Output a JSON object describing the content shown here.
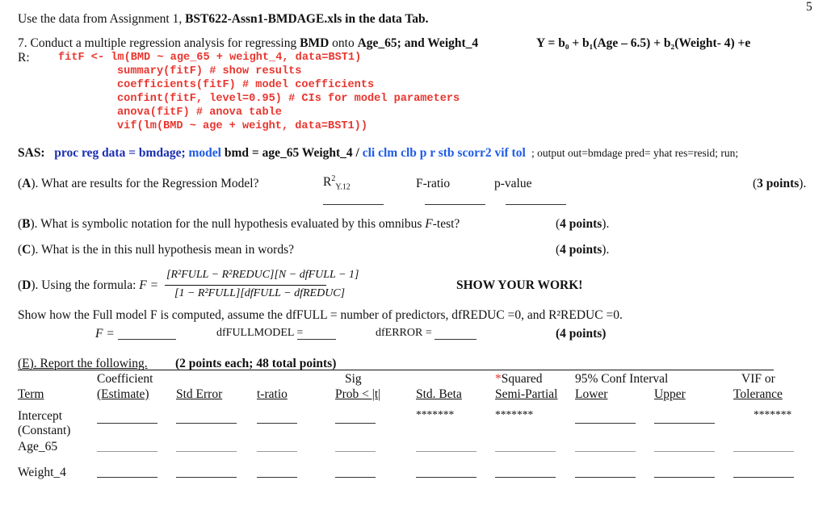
{
  "page_number": "5",
  "intro": {
    "prefix": "Use the data from Assignment 1, ",
    "file": "BST622-Assn1-BMDAGE.xls in the data Tab."
  },
  "q7": {
    "prefix": "7. Conduct a multiple regression analysis for regressing ",
    "bmd": "BMD",
    "onto": " onto ",
    "vars": "Age_65; and Weight_4",
    "model_eq": "Y = b₀ + b₁(Age – 6.5) + b₂(Weight- 4) +e"
  },
  "r_label": "R:",
  "r_code": [
    "fitF <- lm(BMD ~ age_65 + weight_4, data=BST1)",
    "summary(fitF) # show results",
    "coefficients(fitF) # model coefficients",
    "confint(fitF, level=0.95) # CIs for model parameters",
    "anova(fitF) # anova table",
    "vif(lm(BMD ~ age + weight, data=BST1))"
  ],
  "sas": {
    "label": "SAS:",
    "proc": "proc reg data = bmdage;",
    "model_kw": "model",
    "model_rest": " bmd = age_65 Weight_4 / ",
    "options": "cli clm clb p r stb scorr2 vif tol",
    "tail": " ; output out=bmdage  pred= yhat  res=resid;  run;"
  },
  "A": {
    "label": "A",
    "text": "). What are results for the Regression Model?",
    "r2": "R",
    "r2_sup": "2",
    "r2_sub": "Y.12",
    "fratio": "F-ratio",
    "pvalue": "p-value",
    "points": "3 points"
  },
  "B": {
    "label": "B",
    "text": ").  What is symbolic notation for the null hypothesis evaluated by this omnibus ",
    "f": "F",
    "text2": "-test?",
    "points": "4 points"
  },
  "C": {
    "label": "C",
    "text": ").  What is the in this null hypothesis mean in words?",
    "points": "4 points"
  },
  "D": {
    "label": "D",
    "text": "). Using the formula: ",
    "formula_lhs": "F =",
    "numerator": "[R²FULL − R²REDUC][N − dfFULL − 1]",
    "denominator": "[1 − R²FULL][dfFULL − dfREDUC]",
    "show_work": "SHOW YOUR WORK!",
    "assume": "Show how the Full model F is computed, assume the dfFULL = number of predictors, dfREDUC =0, and R²REDUC =0.",
    "f_eq": "F =",
    "df_full_model": "dfFULLMODEL =",
    "df_error": "dfERROR =",
    "points": "(4 points)"
  },
  "E": {
    "title": "(E). Report the following.",
    "points": "(2 points each; 48 total points)",
    "headers_top": [
      "",
      "Coefficient",
      "",
      "",
      "Sig",
      "",
      "*Squared",
      "95% Conf Interval",
      "",
      "VIF or"
    ],
    "headers": [
      "Term",
      "(Estimate)",
      "Std Error",
      "t-ratio",
      "Prob < |t|",
      "Std. Beta",
      "Semi-Partial",
      "Lower",
      "Upper",
      "Tolerance"
    ],
    "rows": [
      {
        "term": "Intercept",
        "term2": "(Constant)",
        "stars": "*******"
      },
      {
        "term": "Age_65"
      },
      {
        "term": "Weight_4"
      }
    ]
  }
}
